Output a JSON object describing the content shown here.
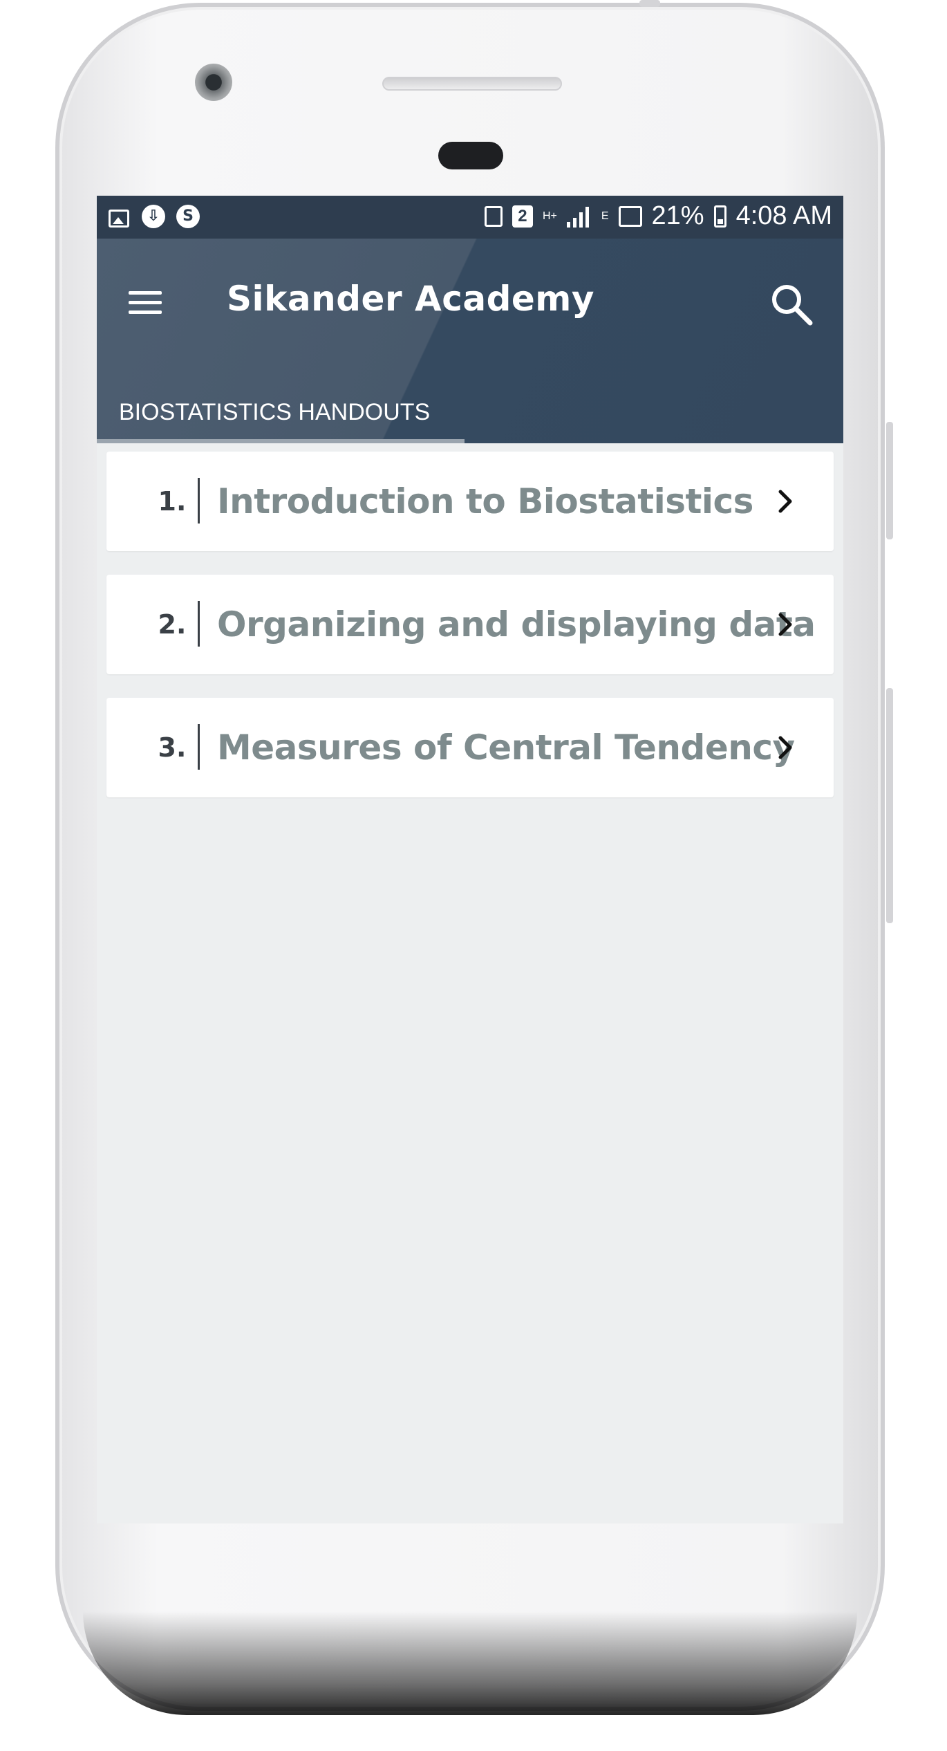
{
  "status_bar": {
    "battery_percent": "21%",
    "time": "4:08 AM",
    "sim_badge": "2",
    "network_type": "H+",
    "network_secondary": "E"
  },
  "app_bar": {
    "title": "Sikander Academy",
    "menu_icon": "hamburger-menu-icon",
    "search_icon": "search-icon",
    "primary_color": "#34485e"
  },
  "tabs": [
    {
      "label": "BIOSTATISTICS HANDOUTS",
      "selected": true
    }
  ],
  "handouts": [
    {
      "number": "1.",
      "title": "Introduction to Biostatistics"
    },
    {
      "number": "2.",
      "title": "Organizing and displaying data"
    },
    {
      "number": "3.",
      "title": "Measures of Central Tendency"
    }
  ]
}
